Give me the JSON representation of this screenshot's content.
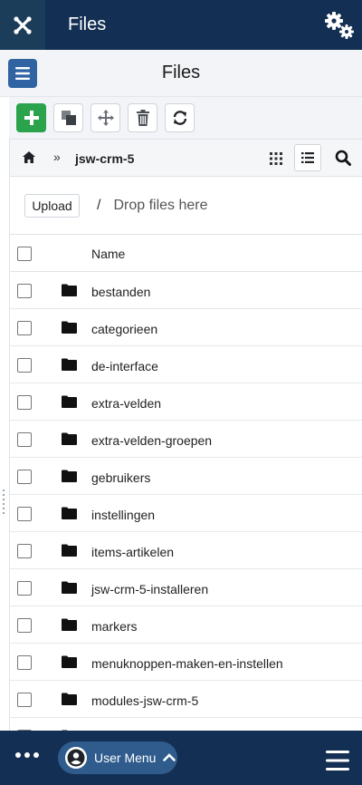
{
  "header": {
    "title": "Files"
  },
  "subheader": {
    "title": "Files"
  },
  "path": {
    "separator": "»",
    "current": "jsw-crm-5"
  },
  "upload": {
    "button_label": "Upload",
    "slash": "/",
    "drop_text": "Drop files here"
  },
  "table": {
    "name_header": "Name",
    "rows": [
      "bestanden",
      "categorieen",
      "de-interface",
      "extra-velden",
      "extra-velden-groepen",
      "gebruikers",
      "instellingen",
      "items-artikelen",
      "jsw-crm-5-installeren",
      "markers",
      "menuknoppen-maken-en-instellen",
      "modules-jsw-crm-5"
    ]
  },
  "bottom": {
    "user_menu_label": "User Menu"
  },
  "colors": {
    "header_bg": "#132f53",
    "add_button": "#2ba24c",
    "menu_toggle": "#2f63a2",
    "user_menu_bg": "#2f5c8d"
  },
  "icons": [
    "joomla-logo-icon",
    "gears-icon",
    "menu-toggle-icon",
    "plus-icon",
    "copy-icon",
    "move-icon",
    "trash-icon",
    "refresh-icon",
    "home-icon",
    "grid-view-icon",
    "list-view-icon",
    "search-icon",
    "folder-icon",
    "more-dots-icon",
    "user-avatar-icon",
    "chevron-up-icon",
    "hamburger-icon"
  ]
}
